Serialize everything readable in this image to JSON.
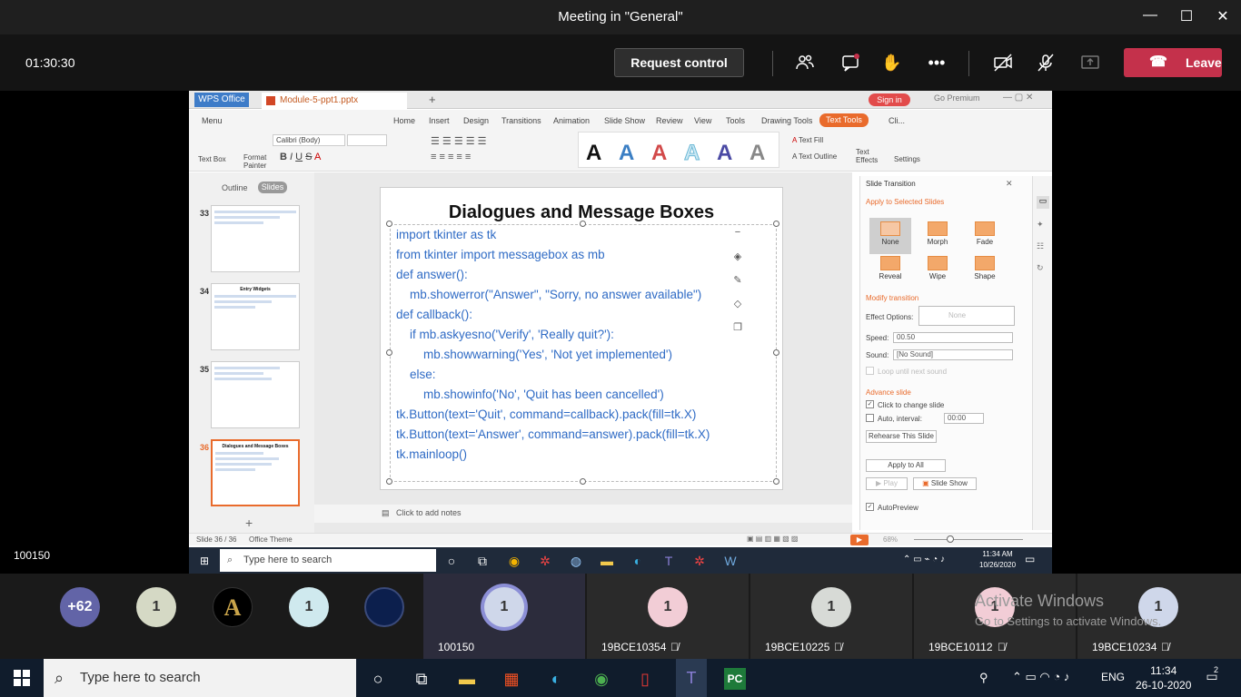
{
  "teams": {
    "title": "Meeting in \"General\"",
    "timer": "01:30:30",
    "request_control": "Request control",
    "leave": "Leave",
    "presenter": "100150"
  },
  "wps": {
    "app_tab": "WPS Office",
    "doc_tab": "Module-5-ppt1.pptx",
    "signin": "Sign in",
    "go_premium": "Go Premium",
    "menu": [
      "Menu",
      "Home",
      "Insert",
      "Design",
      "Transitions",
      "Animation",
      "Slide Show",
      "Review",
      "View",
      "Tools",
      "Drawing Tools",
      "Text Tools",
      "Cli..."
    ],
    "ribbon": {
      "textbox": "Text Box",
      "format_painter": "Format Painter",
      "font": "Calibri (Body)",
      "text_fill": "Text Fill",
      "text_outline": "Text Outline",
      "text_effects": "Text Effects",
      "settings": "Settings"
    },
    "panel_tabs": {
      "outline": "Outline",
      "slides": "Slides"
    },
    "thumbs": [
      {
        "num": "33",
        "title": ""
      },
      {
        "num": "34",
        "title": "Entry Widgets"
      },
      {
        "num": "35",
        "title": ""
      },
      {
        "num": "36",
        "title": "Dialogues and Message Boxes"
      }
    ],
    "slide": {
      "title": "Dialogues and Message Boxes",
      "code": [
        "import tkinter as tk",
        "from tkinter import messagebox as mb",
        "def answer():",
        "    mb.showerror(\"Answer\", \"Sorry, no answer available\")",
        "def callback():",
        "    if mb.askyesno('Verify', 'Really quit?'):",
        "        mb.showwarning('Yes', 'Not yet implemented')",
        "    else:",
        "        mb.showinfo('No', 'Quit has been cancelled')",
        "tk.Button(text='Quit', command=callback).pack(fill=tk.X)",
        "tk.Button(text='Answer', command=answer).pack(fill=tk.X)",
        "tk.mainloop()"
      ]
    },
    "notes": "Click to add notes",
    "transition": {
      "header": "Slide Transition",
      "apply_selected": "Apply to Selected Slides",
      "effects": [
        "None",
        "Morph",
        "Fade",
        "Reveal",
        "Wipe",
        "Shape"
      ],
      "modify": "Modify transition",
      "effect_options": "Effect Options:",
      "effect_value": "None",
      "speed_label": "Speed:",
      "speed_value": "00.50",
      "sound_label": "Sound:",
      "sound_value": "[No Sound]",
      "loop": "Loop until next sound",
      "advance": "Advance slide",
      "click_change": "Click to change slide",
      "auto_interval": "Auto, interval:",
      "interval_value": "00:00",
      "rehearse": "Rehearse This Slide",
      "apply_all": "Apply to All",
      "play": "Play",
      "slideshow": "Slide Show",
      "autopreview": "AutoPreview"
    },
    "status": {
      "slide": "Slide 36 / 36",
      "theme": "Office Theme",
      "zoom": "68%"
    },
    "inner_taskbar": {
      "search": "Type here to search",
      "time": "11:34 AM",
      "date": "10/26/2020"
    }
  },
  "participants": {
    "bubbles": [
      "+62",
      "1",
      "1"
    ],
    "tiles": [
      {
        "name": "100150",
        "initial": "1"
      },
      {
        "name": "19BCE10354",
        "initial": "1"
      },
      {
        "name": "19BCE10225",
        "initial": "1"
      },
      {
        "name": "19BCE10112",
        "initial": "1"
      },
      {
        "name": "19BCE10234",
        "initial": "1"
      }
    ],
    "activate_l1": "Activate Windows",
    "activate_l2": "Go to Settings to activate Windows."
  },
  "taskbar": {
    "search": "Type here to search",
    "lang": "ENG",
    "time": "11:34",
    "date": "26-10-2020",
    "notif_count": "2"
  }
}
